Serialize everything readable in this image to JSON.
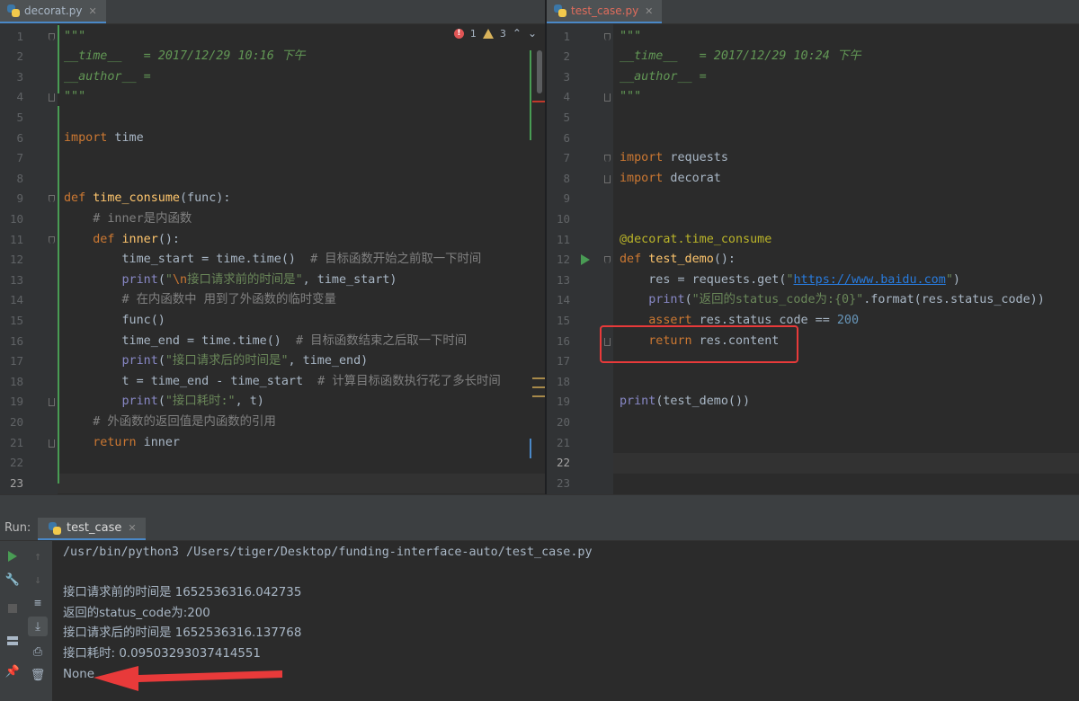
{
  "left": {
    "tab_label": "decorat.py",
    "inspection": {
      "errors": "1",
      "warnings": "3"
    },
    "lines": [
      {
        "n": "1",
        "html": "<span class=\"doc\">\"\"\"</span>"
      },
      {
        "n": "2",
        "html": "<span class=\"doc\">__time__   = 2017/12/29 10:16 下午</span>"
      },
      {
        "n": "3",
        "html": "<span class=\"doc\">__author__ = </span>"
      },
      {
        "n": "4",
        "html": "<span class=\"doc\">\"\"\"</span>"
      },
      {
        "n": "5",
        "html": ""
      },
      {
        "n": "6",
        "html": "<span class=\"kw\">import</span> time"
      },
      {
        "n": "7",
        "html": ""
      },
      {
        "n": "8",
        "html": ""
      },
      {
        "n": "9",
        "html": "<span class=\"kw\">def</span> <span class=\"fn\">time_consume</span>(func):"
      },
      {
        "n": "10",
        "html": "    <span class=\"cm\"># inner是内函数</span>"
      },
      {
        "n": "11",
        "html": "    <span class=\"kw\">def</span> <span class=\"fn\">inner</span>():"
      },
      {
        "n": "12",
        "html": "        time_start = time.time()  <span class=\"cm\"># 目标函数开始之前取一下时间</span>"
      },
      {
        "n": "13",
        "html": "        <span class=\"bi\">print</span>(<span class=\"str\">\"<span class=\"esc\">\\n</span>接口请求前的时间是\"</span>, time_start)"
      },
      {
        "n": "14",
        "html": "        <span class=\"cm\"># 在内函数中 用到了外函数的临时变量</span>"
      },
      {
        "n": "15",
        "html": "        func()"
      },
      {
        "n": "16",
        "html": "        time_end = time.time()  <span class=\"cm\"># 目标函数结束之后取一下时间</span>"
      },
      {
        "n": "17",
        "html": "        <span class=\"bi\">print</span>(<span class=\"str\">\"接口请求后的时间是\"</span>, time_end)"
      },
      {
        "n": "18",
        "html": "        t = time_end - time_start  <span class=\"cm\"># 计算目标函数执行花了多长时间</span>"
      },
      {
        "n": "19",
        "html": "        <span class=\"bi\">print</span>(<span class=\"str\">\"接口耗时:\"</span>, t)"
      },
      {
        "n": "20",
        "html": "    <span class=\"cm\"># 外函数的返回值是内函数的引用</span>"
      },
      {
        "n": "21",
        "html": "    <span class=\"kw\">return</span> inner"
      },
      {
        "n": "22",
        "html": ""
      },
      {
        "n": "23",
        "html": ""
      }
    ]
  },
  "right": {
    "tab_label": "test_case.py",
    "lines": [
      {
        "n": "1",
        "html": "<span class=\"doc\">\"\"\"</span>"
      },
      {
        "n": "2",
        "html": "<span class=\"doc\">__time__   = 2017/12/29 10:24 下午</span>"
      },
      {
        "n": "3",
        "html": "<span class=\"doc\">__author__ = </span>"
      },
      {
        "n": "4",
        "html": "<span class=\"doc\">\"\"\"</span>"
      },
      {
        "n": "5",
        "html": ""
      },
      {
        "n": "6",
        "html": ""
      },
      {
        "n": "7",
        "html": "<span class=\"kw\">import</span> requests"
      },
      {
        "n": "8",
        "html": "<span class=\"kw\">import</span> decorat"
      },
      {
        "n": "9",
        "html": ""
      },
      {
        "n": "10",
        "html": ""
      },
      {
        "n": "11",
        "html": "<span class=\"dec\">@decorat.time_consume</span>"
      },
      {
        "n": "12",
        "html": "<span class=\"kw\">def</span> <span class=\"fn\">test_demo</span>():"
      },
      {
        "n": "13",
        "html": "    res = requests.get(<span class=\"str\">\"<span class=\"url\">https://www.baidu.com</span>\"</span>)"
      },
      {
        "n": "14",
        "html": "    <span class=\"bi\">print</span>(<span class=\"str\">\"返回的status_code为:{0}\"</span>.format(res.status_code))"
      },
      {
        "n": "15",
        "html": "    <span class=\"kw\">assert</span> res.status_code == <span class=\"num\">200</span>"
      },
      {
        "n": "16",
        "html": "    <span class=\"kw\">return</span> res.content"
      },
      {
        "n": "17",
        "html": ""
      },
      {
        "n": "18",
        "html": ""
      },
      {
        "n": "19",
        "html": "<span class=\"bi\">print</span>(test_demo())"
      },
      {
        "n": "20",
        "html": ""
      },
      {
        "n": "21",
        "html": ""
      },
      {
        "n": "22",
        "html": ""
      },
      {
        "n": "23",
        "html": ""
      }
    ]
  },
  "run": {
    "label": "Run:",
    "tab_label": "test_case",
    "console": [
      "/usr/bin/python3 /Users/tiger/Desktop/funding-interface-auto/test_case.py",
      "",
      "接口请求前的时间是 1652536316.042735",
      "返回的status_code为:200",
      "接口请求后的时间是 1652536316.137768",
      "接口耗时: 0.09503293037414551",
      "None"
    ]
  },
  "colors": {
    "keyword": "#cc7832",
    "string": "#6a8759",
    "function": "#ffc66d",
    "comment": "#808080",
    "highlight": "#e83a3a"
  }
}
